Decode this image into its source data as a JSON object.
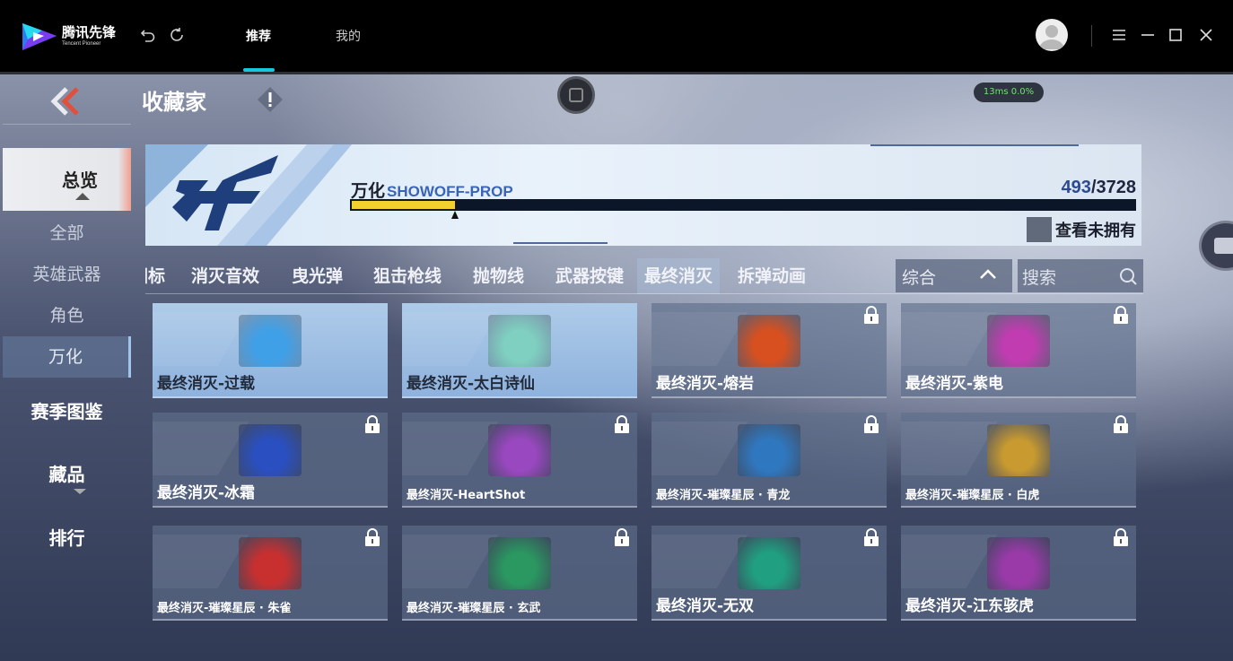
{
  "topbar": {
    "logo_cn": "腾讯先锋",
    "logo_en": "Tencent Pioneer",
    "tabs": [
      {
        "label": "推荐",
        "active": true
      },
      {
        "label": "我的",
        "active": false
      }
    ],
    "accent_color": "#15c8e0"
  },
  "game": {
    "page_title": "收藏家",
    "ping": "13ms  0.0%",
    "sidebar": {
      "overview": "总览",
      "sub_items": [
        "全部",
        "英雄武器",
        "角色",
        "万化"
      ],
      "selected_sub": "万化",
      "main_items": [
        "赛季图鉴",
        "藏品",
        "排行"
      ]
    },
    "banner": {
      "title_cn": "万化",
      "title_en": "SHOWOFF-PROP",
      "count_current": "493",
      "count_total": "/3728",
      "progress_fraction": 0.1322,
      "unowned_label": "查看未拥有"
    },
    "filters": {
      "tabs": [
        "图标",
        "消灭音效",
        "曳光弹",
        "狙击枪线",
        "抛物线",
        "武器按键",
        "最终消灭",
        "拆弹动画"
      ],
      "selected": "最终消灭",
      "sort_label": "综合",
      "search_placeholder": "搜索"
    },
    "items": [
      {
        "name": "最终消灭-过载",
        "owned": true,
        "color": "#3fa0e8"
      },
      {
        "name": "最终消灭-太白诗仙",
        "owned": true,
        "color": "#7fd0c0"
      },
      {
        "name": "最终消灭-熔岩",
        "owned": false,
        "color": "#d85020"
      },
      {
        "name": "最终消灭-紫电",
        "owned": false,
        "color": "#c03cb0"
      },
      {
        "name": "最终消灭-冰霜",
        "owned": false,
        "color": "#2a4fc0"
      },
      {
        "name": "最终消灭-HeartShot",
        "owned": false,
        "color": "#9a48c0"
      },
      {
        "name": "最终消灭-璀璨星辰 · 青龙",
        "owned": false,
        "color": "#2f78c0"
      },
      {
        "name": "最终消灭-璀璨星辰 · 白虎",
        "owned": false,
        "color": "#c89a30"
      },
      {
        "name": "最终消灭-璀璨星辰 · 朱雀",
        "owned": false,
        "color": "#c83030"
      },
      {
        "name": "最终消灭-璀璨星辰 · 玄武",
        "owned": false,
        "color": "#2a9860"
      },
      {
        "name": "最终消灭-无双",
        "owned": false,
        "color": "#20a080"
      },
      {
        "name": "最终消灭-江东骇虎",
        "owned": false,
        "color": "#9a3aa8"
      }
    ]
  }
}
